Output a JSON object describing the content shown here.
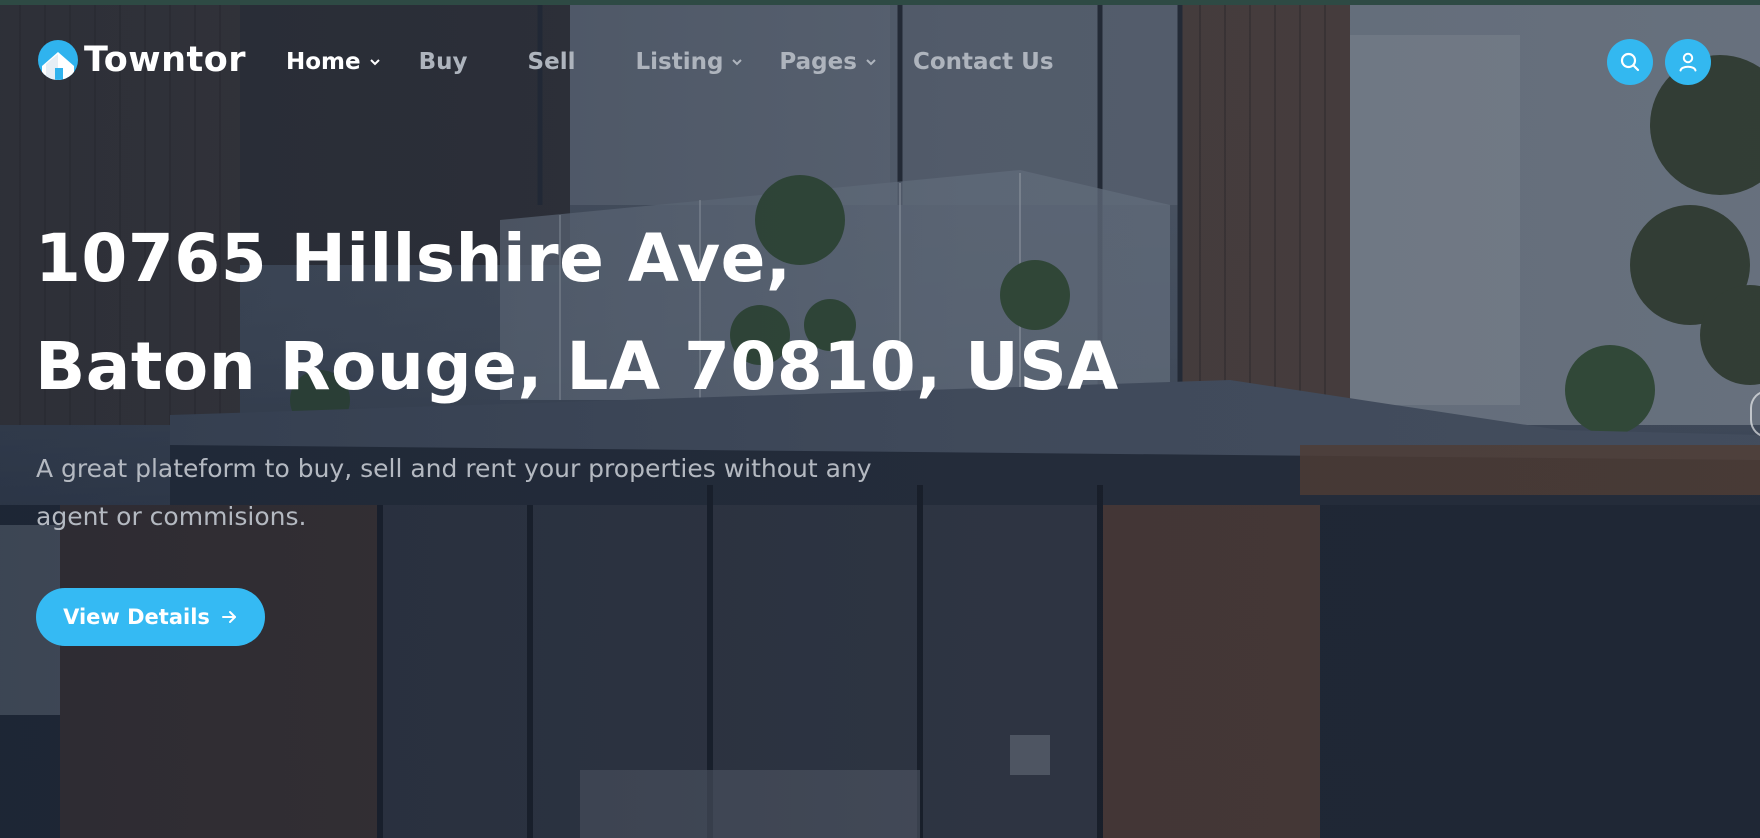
{
  "brand": {
    "name": "Towntor",
    "accent": "#35baf3"
  },
  "nav": {
    "items": [
      {
        "label": "Home",
        "active": true,
        "has_dropdown": true
      },
      {
        "label": "Buy",
        "active": false,
        "has_dropdown": false
      },
      {
        "label": "Sell",
        "active": false,
        "has_dropdown": false
      },
      {
        "label": "Listing",
        "active": false,
        "has_dropdown": true
      },
      {
        "label": "Pages",
        "active": false,
        "has_dropdown": true
      },
      {
        "label": "Contact Us",
        "active": false,
        "has_dropdown": false
      }
    ]
  },
  "header_actions": {
    "search_icon": "search-icon",
    "user_icon": "user-icon"
  },
  "hero": {
    "title_line1": "10765 Hillshire Ave,",
    "title_line2": "Baton Rouge, LA 70810, USA",
    "description": "A great plateform to buy, sell and rent your properties without any agent or commisions.",
    "cta_label": "View Details",
    "cta_icon": "arrow-right-icon"
  }
}
